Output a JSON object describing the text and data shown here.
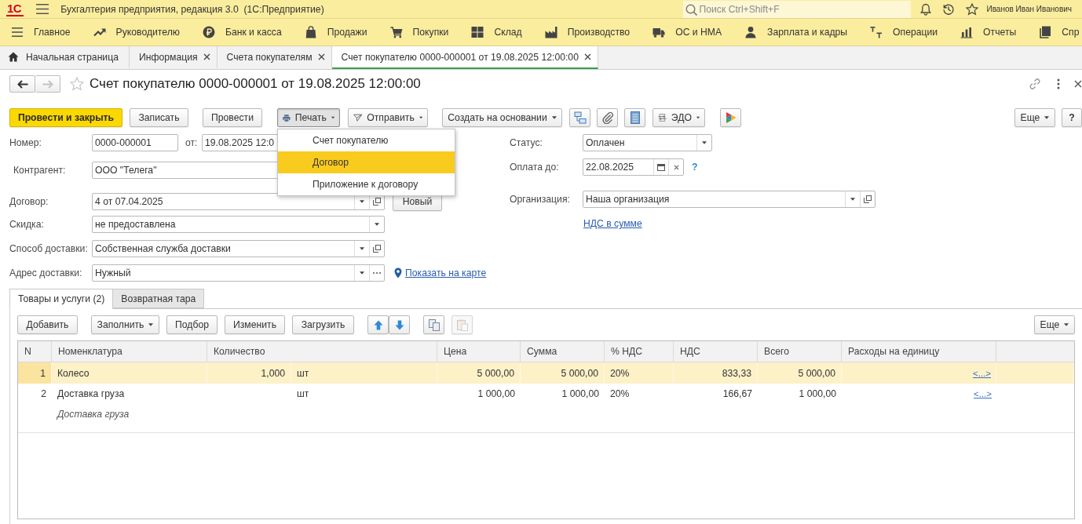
{
  "app": {
    "logo": "1С",
    "title": "Бухгалтерия предприятия, редакция 3.0  (1С:Предприятие)",
    "search": {
      "placeholder": "Поиск Ctrl+Shift+F"
    },
    "user": "Иванов Иван Иванович"
  },
  "sections": [
    {
      "kind": "main",
      "label": "Главное"
    },
    {
      "kind": "manager",
      "label": "Руководителю"
    },
    {
      "kind": "bank",
      "label": "Банк и касса"
    },
    {
      "kind": "sales",
      "label": "Продажи"
    },
    {
      "kind": "purchases",
      "label": "Покупки"
    },
    {
      "kind": "warehouse",
      "label": "Склад"
    },
    {
      "kind": "production",
      "label": "Производство"
    },
    {
      "kind": "assets",
      "label": "ОС и НМА"
    },
    {
      "kind": "salary",
      "label": "Зарплата и кадры"
    },
    {
      "kind": "operations",
      "label": "Операции"
    },
    {
      "kind": "reports",
      "label": "Отчеты"
    },
    {
      "kind": "reference",
      "label": "Спр"
    }
  ],
  "open_tabs": [
    {
      "kind": "home",
      "label": "Начальная страница",
      "selected": false
    },
    {
      "kind": "page",
      "label": "Информация",
      "selected": false
    },
    {
      "kind": "page",
      "label": "Счета покупателям",
      "selected": false
    },
    {
      "kind": "page",
      "label": "Счет покупателю 0000-000001 от 19.08.2025 12:00:00",
      "selected": true
    }
  ],
  "form": {
    "title": "Счет покупателю 0000-000001 от 19.08.2025 12:00:00",
    "favorite": false,
    "nav": [
      {
        "kind": "back",
        "disabled": false
      },
      {
        "kind": "forward",
        "disabled": true
      }
    ]
  },
  "commands": {
    "post_and_close": "Провести и закрыть",
    "save": "Записать",
    "post": "Провести",
    "print": {
      "label": "Печать",
      "expanded": true
    },
    "send": "Отправить",
    "create_based_on": "Создать на основании",
    "edo": "ЭДО",
    "more": "Еще",
    "help": "?"
  },
  "print_menu": [
    {
      "label": "Счет покупателю",
      "selected": false
    },
    {
      "label": "Договор",
      "selected": true
    },
    {
      "label": "Приложение к договору",
      "selected": false
    }
  ],
  "fields": {
    "number": {
      "label": "Номер:",
      "value": "0000-000001"
    },
    "date": {
      "label": "от:",
      "value": "19.08.2025 12:0"
    },
    "counterparty": {
      "label": "Контрагент:",
      "value": "ООО \"Телега\""
    },
    "contract": {
      "label": "Договор:",
      "value": "4 от 07.04.2025",
      "buttons": [
        {
          "kind": "dropdown"
        },
        {
          "kind": "open"
        }
      ],
      "new_button": "Новый"
    },
    "discount": {
      "label": "Скидка:",
      "value": "не предоставлена",
      "buttons": [
        {
          "kind": "dropdown"
        }
      ]
    },
    "delivery_method": {
      "label": "Способ доставки:",
      "value": "Собственная служба доставки",
      "buttons": [
        {
          "kind": "dropdown"
        },
        {
          "kind": "open"
        }
      ]
    },
    "delivery_address": {
      "label": "Адрес доставки:",
      "value": "Нужный",
      "buttons": [
        {
          "kind": "dropdown"
        },
        {
          "kind": "ellipsis"
        }
      ],
      "map_link": "Показать на карте"
    },
    "status": {
      "label": "Статус:",
      "value": "Оплачен",
      "buttons": [
        {
          "kind": "dropdown"
        }
      ]
    },
    "pay_by": {
      "label": "Оплата до:",
      "value": "22.08.2025",
      "buttons": [
        {
          "kind": "calendar"
        },
        {
          "kind": "clear"
        }
      ],
      "help": "?"
    },
    "organization": {
      "label": "Организация:",
      "value": "Наша организация",
      "buttons": [
        {
          "kind": "dropdown"
        },
        {
          "kind": "open"
        }
      ]
    },
    "vat_link": "НДС в сумме"
  },
  "form_tabs": [
    {
      "label": "Товары и услуги (2)",
      "selected": true
    },
    {
      "label": "Возвратная тара",
      "selected": false
    }
  ],
  "table_toolbar": {
    "add": "Добавить",
    "fill": "Заполнить",
    "pick": "Подбор",
    "edit": "Изменить",
    "load": "Загрузить",
    "icon_buttons": [
      {
        "kind": "up",
        "disabled": false
      },
      {
        "kind": "down",
        "disabled": false
      },
      {
        "kind": "copy",
        "disabled": false
      },
      {
        "kind": "paste",
        "disabled": true
      }
    ],
    "more": "Еще"
  },
  "table": {
    "columns": [
      "N",
      "Номенклатура",
      "Количество",
      "Цена",
      "Сумма",
      "% НДС",
      "НДС",
      "Всего",
      "Расходы на единицу"
    ],
    "rows": [
      {
        "n": "1",
        "name": "Колесо",
        "quantity": "1,000",
        "unit": "шт",
        "price": "5 000,00",
        "sum": "5 000,00",
        "vat_rate": "20%",
        "vat": "833,33",
        "total": "5 000,00",
        "costs": "<...>",
        "selected": true
      },
      {
        "n": "2",
        "name": "Доставка груза",
        "content": "Доставка груза",
        "unit": "шт",
        "price": "1 000,00",
        "sum": "1 000,00",
        "vat_rate": "20%",
        "vat": "166,67",
        "total": "1 000,00",
        "costs": "<...>",
        "selected": false
      }
    ]
  }
}
